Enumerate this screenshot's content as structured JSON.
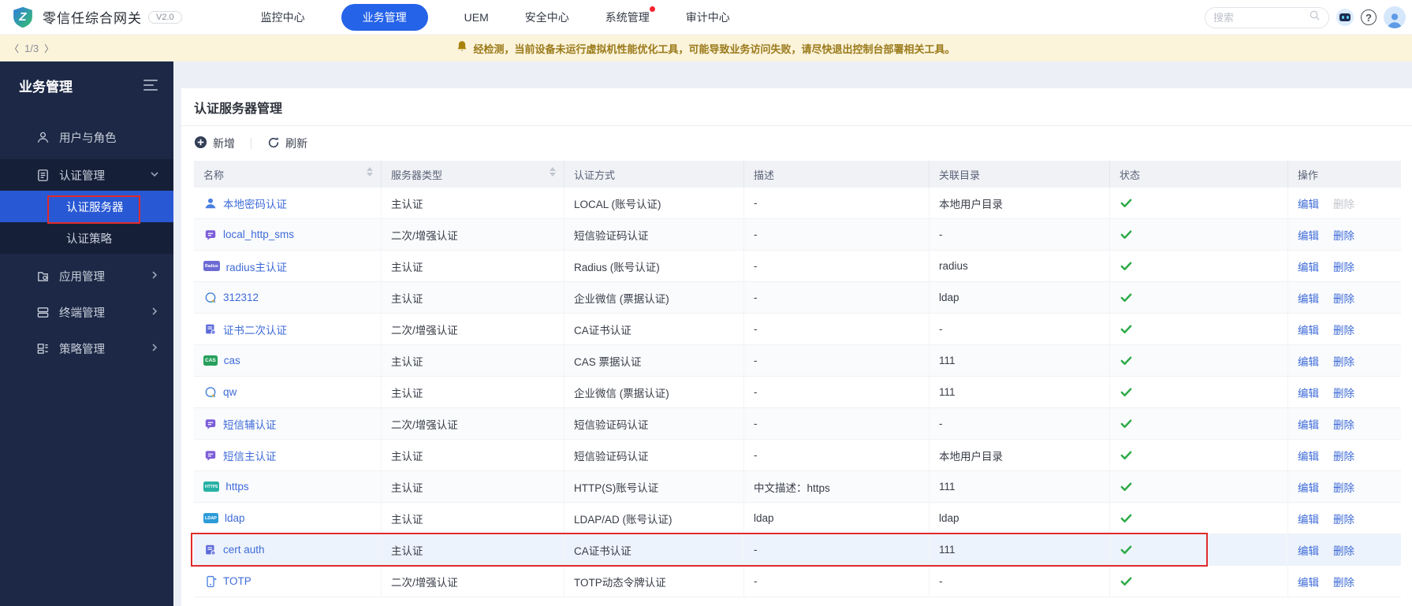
{
  "topbar": {
    "logo_letter": "Z",
    "title": "零信任综合网关",
    "version": "V2.0",
    "nav": [
      {
        "label": "监控中心"
      },
      {
        "label": "业务管理",
        "active": true
      },
      {
        "label": "UEM"
      },
      {
        "label": "安全中心"
      },
      {
        "label": "系统管理",
        "dot": true
      },
      {
        "label": "审计中心"
      }
    ],
    "search_placeholder": "搜索",
    "help_glyph": "?"
  },
  "pager": {
    "prev": "〈",
    "label": "1/3",
    "next": "〉"
  },
  "banner": {
    "text": "经检测，当前设备未运行虚拟机性能优化工具，可能导致业务访问失败，请尽快退出控制台部署相关工具。"
  },
  "sidebar": {
    "title": "业务管理",
    "items": [
      {
        "label": "用户与角色",
        "icon": "user-menu"
      },
      {
        "label": "认证管理",
        "icon": "auth-doc",
        "expanded": true,
        "children": [
          {
            "label": "认证服务器",
            "selected": true,
            "annotated": true
          },
          {
            "label": "认证策略"
          }
        ]
      },
      {
        "label": "应用管理",
        "icon": "app",
        "collapsed": true
      },
      {
        "label": "终端管理",
        "icon": "terminal",
        "collapsed": true
      },
      {
        "label": "策略管理",
        "icon": "policy",
        "collapsed": true
      }
    ]
  },
  "main": {
    "title": "认证服务器管理",
    "toolbar": {
      "add_label": "新增",
      "refresh_label": "刷新"
    },
    "table": {
      "columns": [
        {
          "label": "名称",
          "sortable": true
        },
        {
          "label": "服务器类型",
          "sortable": true
        },
        {
          "label": "认证方式"
        },
        {
          "label": "描述"
        },
        {
          "label": "关联目录"
        },
        {
          "label": "状态"
        },
        {
          "label": "操作"
        }
      ],
      "edit_label": "编辑",
      "delete_label": "删除",
      "rows": [
        {
          "icon": "user-row",
          "name": "本地密码认证",
          "type": "主认证",
          "method": "LOCAL (账号认证)",
          "desc": "-",
          "directory": "本地用户目录",
          "status": "enabled",
          "delete_disabled": true
        },
        {
          "icon": "sms",
          "name": "local_http_sms",
          "type": "二次/增强认证",
          "method": "短信验证码认证",
          "desc": "-",
          "directory": "-",
          "status": "enabled"
        },
        {
          "icon": "badge-radius",
          "badge_text": "Radius",
          "name": "radius主认证",
          "type": "主认证",
          "method": "Radius (账号认证)",
          "desc": "-",
          "directory": "radius",
          "status": "enabled"
        },
        {
          "icon": "wechat",
          "name": "312312",
          "type": "主认证",
          "method": "企业微信 (票据认证)",
          "desc": "-",
          "directory": "ldap",
          "status": "enabled"
        },
        {
          "icon": "cert",
          "name": "证书二次认证",
          "type": "二次/增强认证",
          "method": "CA证书认证",
          "desc": "-",
          "directory": "-",
          "status": "enabled"
        },
        {
          "icon": "badge-cas",
          "badge_text": "CAS",
          "name": "cas",
          "type": "主认证",
          "method": "CAS 票据认证",
          "desc": "-",
          "directory": "111",
          "status": "enabled"
        },
        {
          "icon": "wechat",
          "name": "qw",
          "type": "主认证",
          "method": "企业微信 (票据认证)",
          "desc": "-",
          "directory": "111",
          "status": "enabled"
        },
        {
          "icon": "sms",
          "name": "短信辅认证",
          "type": "二次/增强认证",
          "method": "短信验证码认证",
          "desc": "-",
          "directory": "-",
          "status": "enabled"
        },
        {
          "icon": "sms",
          "name": "短信主认证",
          "type": "主认证",
          "method": "短信验证码认证",
          "desc": "-",
          "directory": "本地用户目录",
          "status": "enabled"
        },
        {
          "icon": "badge-https",
          "badge_text": "HTTPS",
          "name": "https",
          "type": "主认证",
          "method": "HTTP(S)账号认证",
          "desc": "中文描述：https",
          "directory": "111",
          "status": "enabled"
        },
        {
          "icon": "badge-ldap",
          "badge_text": "LDAP",
          "name": "ldap",
          "type": "主认证",
          "method": "LDAP/AD (账号认证)",
          "desc": "ldap",
          "directory": "ldap",
          "status": "enabled"
        },
        {
          "icon": "cert",
          "name": "cert auth",
          "type": "主认证",
          "method": "CA证书认证",
          "desc": "-",
          "directory": "111",
          "status": "enabled",
          "highlighted": true,
          "annotated": true
        },
        {
          "icon": "totp",
          "name": "TOTP",
          "type": "二次/增强认证",
          "method": "TOTP动态令牌认证",
          "desc": "-",
          "directory": "-",
          "status": "enabled"
        }
      ]
    }
  },
  "colors": {
    "accent_blue": "#2563e8",
    "link_blue": "#3e6bd8",
    "sidebar_bg": "#1c2845",
    "menu_selected_blue": "#2958d4",
    "success_green": "#2daa47",
    "banner_bg": "#fbf3da",
    "banner_text": "#9a7a1a",
    "annotation_red": "#e02b2b"
  }
}
